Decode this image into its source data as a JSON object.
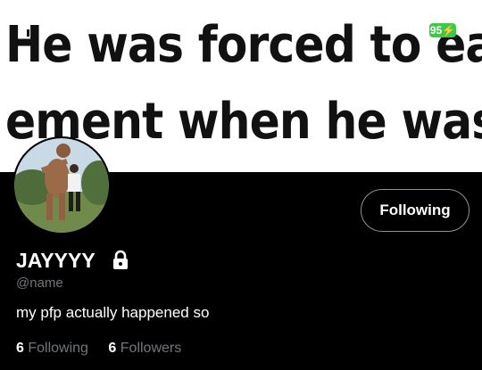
{
  "banner": {
    "line1": "He was forced to eat",
    "line2": "ement when he was ("
  },
  "status": {
    "battery": "95"
  },
  "profile": {
    "display_name": "JAYYYY",
    "handle": "@name",
    "bio": "my pfp actually happened so",
    "following_button_label": "Following",
    "following_count": "6",
    "following_label": "Following",
    "followers_count": "6",
    "followers_label": "Followers"
  },
  "colors": {
    "background": "#000000",
    "muted_text": "#71767b",
    "battery_green": "#3fc74b",
    "button_border": "#8d949b"
  },
  "icons": {
    "lock": "lock-icon",
    "battery": "battery-icon",
    "avatar": "avatar-image"
  }
}
